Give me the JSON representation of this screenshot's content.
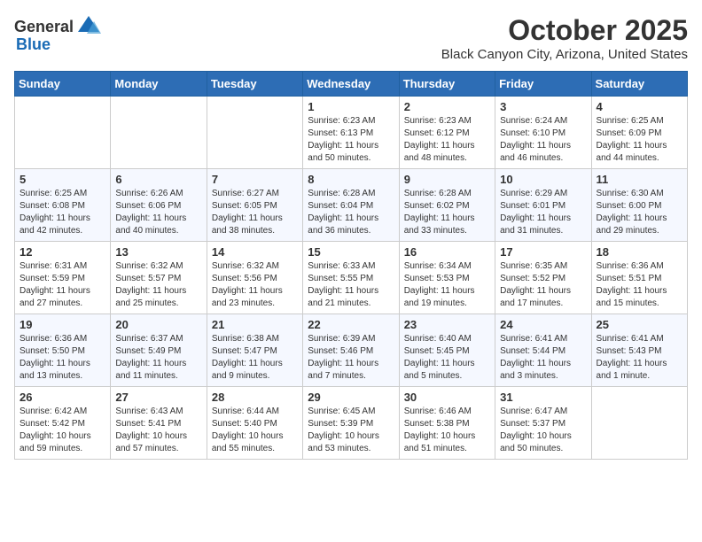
{
  "header": {
    "logo_general": "General",
    "logo_blue": "Blue",
    "month": "October 2025",
    "location": "Black Canyon City, Arizona, United States"
  },
  "weekdays": [
    "Sunday",
    "Monday",
    "Tuesday",
    "Wednesday",
    "Thursday",
    "Friday",
    "Saturday"
  ],
  "weeks": [
    [
      {
        "day": "",
        "info": ""
      },
      {
        "day": "",
        "info": ""
      },
      {
        "day": "",
        "info": ""
      },
      {
        "day": "1",
        "info": "Sunrise: 6:23 AM\nSunset: 6:13 PM\nDaylight: 11 hours\nand 50 minutes."
      },
      {
        "day": "2",
        "info": "Sunrise: 6:23 AM\nSunset: 6:12 PM\nDaylight: 11 hours\nand 48 minutes."
      },
      {
        "day": "3",
        "info": "Sunrise: 6:24 AM\nSunset: 6:10 PM\nDaylight: 11 hours\nand 46 minutes."
      },
      {
        "day": "4",
        "info": "Sunrise: 6:25 AM\nSunset: 6:09 PM\nDaylight: 11 hours\nand 44 minutes."
      }
    ],
    [
      {
        "day": "5",
        "info": "Sunrise: 6:25 AM\nSunset: 6:08 PM\nDaylight: 11 hours\nand 42 minutes."
      },
      {
        "day": "6",
        "info": "Sunrise: 6:26 AM\nSunset: 6:06 PM\nDaylight: 11 hours\nand 40 minutes."
      },
      {
        "day": "7",
        "info": "Sunrise: 6:27 AM\nSunset: 6:05 PM\nDaylight: 11 hours\nand 38 minutes."
      },
      {
        "day": "8",
        "info": "Sunrise: 6:28 AM\nSunset: 6:04 PM\nDaylight: 11 hours\nand 36 minutes."
      },
      {
        "day": "9",
        "info": "Sunrise: 6:28 AM\nSunset: 6:02 PM\nDaylight: 11 hours\nand 33 minutes."
      },
      {
        "day": "10",
        "info": "Sunrise: 6:29 AM\nSunset: 6:01 PM\nDaylight: 11 hours\nand 31 minutes."
      },
      {
        "day": "11",
        "info": "Sunrise: 6:30 AM\nSunset: 6:00 PM\nDaylight: 11 hours\nand 29 minutes."
      }
    ],
    [
      {
        "day": "12",
        "info": "Sunrise: 6:31 AM\nSunset: 5:59 PM\nDaylight: 11 hours\nand 27 minutes."
      },
      {
        "day": "13",
        "info": "Sunrise: 6:32 AM\nSunset: 5:57 PM\nDaylight: 11 hours\nand 25 minutes."
      },
      {
        "day": "14",
        "info": "Sunrise: 6:32 AM\nSunset: 5:56 PM\nDaylight: 11 hours\nand 23 minutes."
      },
      {
        "day": "15",
        "info": "Sunrise: 6:33 AM\nSunset: 5:55 PM\nDaylight: 11 hours\nand 21 minutes."
      },
      {
        "day": "16",
        "info": "Sunrise: 6:34 AM\nSunset: 5:53 PM\nDaylight: 11 hours\nand 19 minutes."
      },
      {
        "day": "17",
        "info": "Sunrise: 6:35 AM\nSunset: 5:52 PM\nDaylight: 11 hours\nand 17 minutes."
      },
      {
        "day": "18",
        "info": "Sunrise: 6:36 AM\nSunset: 5:51 PM\nDaylight: 11 hours\nand 15 minutes."
      }
    ],
    [
      {
        "day": "19",
        "info": "Sunrise: 6:36 AM\nSunset: 5:50 PM\nDaylight: 11 hours\nand 13 minutes."
      },
      {
        "day": "20",
        "info": "Sunrise: 6:37 AM\nSunset: 5:49 PM\nDaylight: 11 hours\nand 11 minutes."
      },
      {
        "day": "21",
        "info": "Sunrise: 6:38 AM\nSunset: 5:47 PM\nDaylight: 11 hours\nand 9 minutes."
      },
      {
        "day": "22",
        "info": "Sunrise: 6:39 AM\nSunset: 5:46 PM\nDaylight: 11 hours\nand 7 minutes."
      },
      {
        "day": "23",
        "info": "Sunrise: 6:40 AM\nSunset: 5:45 PM\nDaylight: 11 hours\nand 5 minutes."
      },
      {
        "day": "24",
        "info": "Sunrise: 6:41 AM\nSunset: 5:44 PM\nDaylight: 11 hours\nand 3 minutes."
      },
      {
        "day": "25",
        "info": "Sunrise: 6:41 AM\nSunset: 5:43 PM\nDaylight: 11 hours\nand 1 minute."
      }
    ],
    [
      {
        "day": "26",
        "info": "Sunrise: 6:42 AM\nSunset: 5:42 PM\nDaylight: 10 hours\nand 59 minutes."
      },
      {
        "day": "27",
        "info": "Sunrise: 6:43 AM\nSunset: 5:41 PM\nDaylight: 10 hours\nand 57 minutes."
      },
      {
        "day": "28",
        "info": "Sunrise: 6:44 AM\nSunset: 5:40 PM\nDaylight: 10 hours\nand 55 minutes."
      },
      {
        "day": "29",
        "info": "Sunrise: 6:45 AM\nSunset: 5:39 PM\nDaylight: 10 hours\nand 53 minutes."
      },
      {
        "day": "30",
        "info": "Sunrise: 6:46 AM\nSunset: 5:38 PM\nDaylight: 10 hours\nand 51 minutes."
      },
      {
        "day": "31",
        "info": "Sunrise: 6:47 AM\nSunset: 5:37 PM\nDaylight: 10 hours\nand 50 minutes."
      },
      {
        "day": "",
        "info": ""
      }
    ]
  ]
}
